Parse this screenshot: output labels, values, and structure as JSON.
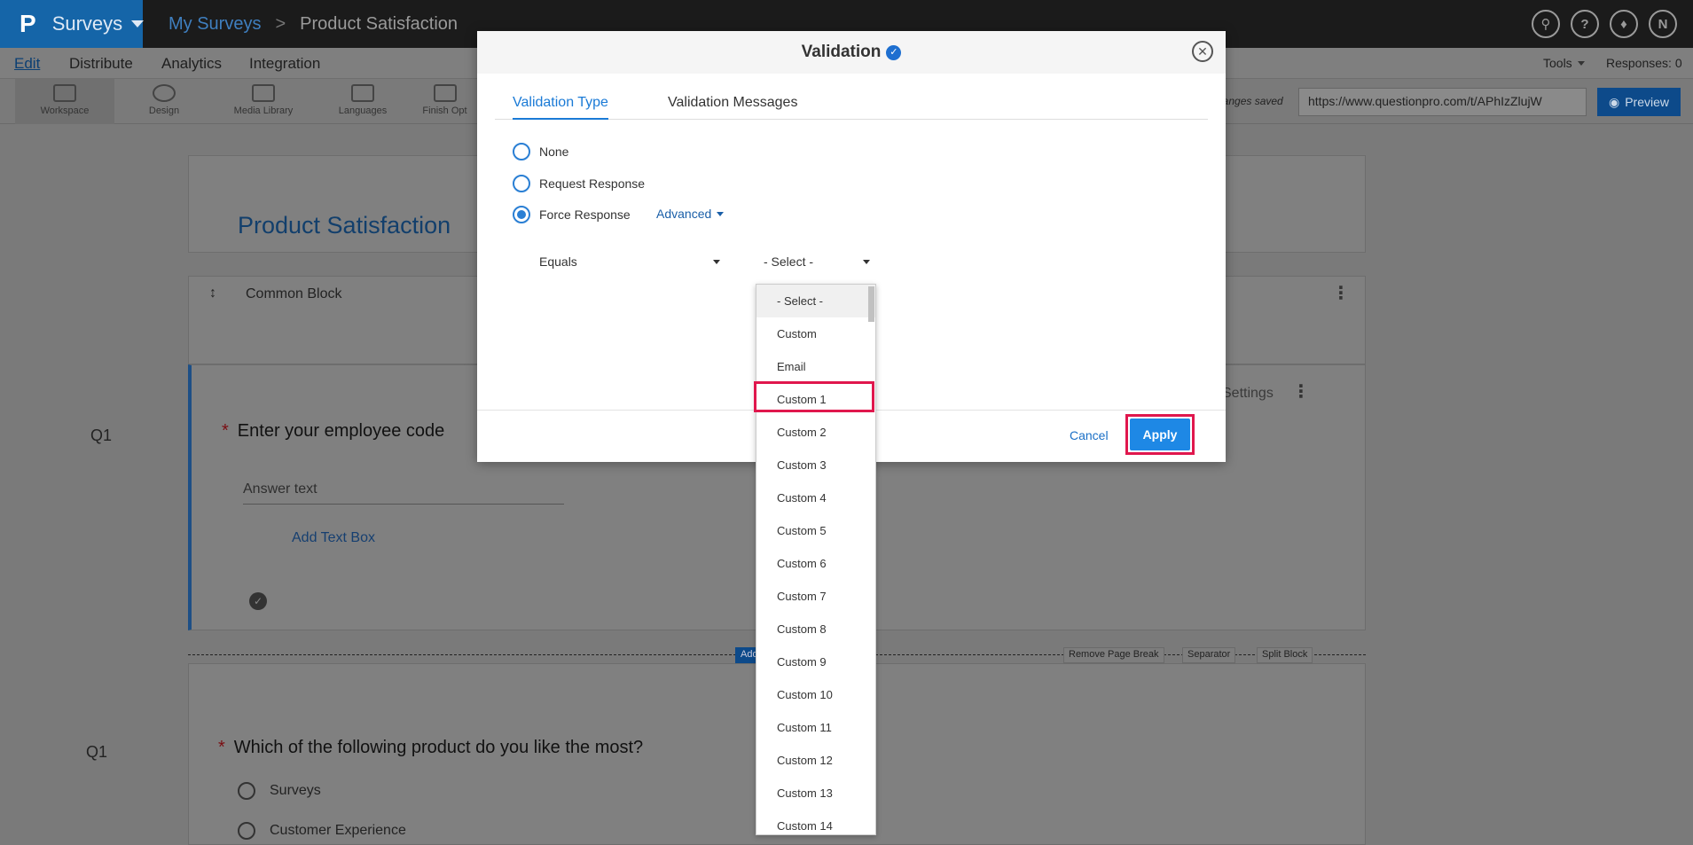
{
  "header": {
    "brand_logo": "P",
    "brand_name": "Surveys",
    "breadcrumb_1": "My Surveys",
    "breadcrumb_sep": ">",
    "breadcrumb_2": "Product Satisfaction",
    "icons": [
      "search-icon",
      "help-icon",
      "bell-icon",
      "user-avatar"
    ],
    "avatar_letter": "N"
  },
  "nav": {
    "items": [
      "Edit",
      "Distribute",
      "Analytics",
      "Integration"
    ],
    "tools": "Tools",
    "responses": "Responses: 0"
  },
  "toolbar": {
    "tools": [
      "Workspace",
      "Design",
      "Media Library",
      "Languages",
      "Finish Opt"
    ],
    "saved_status": "hanges saved",
    "url": "https://www.questionpro.com/t/APhIzZlujW",
    "preview_label": "Preview"
  },
  "survey": {
    "title": "Product Satisfaction",
    "block_label": "Common Block",
    "settings": "Settings",
    "q1_number": "Q1",
    "q1_text": "Enter your employee code",
    "q1_answer_placeholder": "Answer text",
    "add_text_box": "Add Text Box",
    "q2_number": "Q1",
    "q2_text": "Which of the following product do you like the most?",
    "q2_options": [
      "Surveys",
      "Customer Experience"
    ],
    "page_break_buttons": [
      "Remove Page Break",
      "Separator",
      "Split Block"
    ],
    "add_label": "Add"
  },
  "modal": {
    "title": "Validation",
    "tabs": [
      "Validation Type",
      "Validation Messages"
    ],
    "options": [
      "None",
      "Request Response",
      "Force Response"
    ],
    "selected_option": "Force Response",
    "advanced_label": "Advanced",
    "condition_select": "Equals",
    "value_select": "- Select -",
    "cancel_label": "Cancel",
    "apply_label": "Apply"
  },
  "dropdown": {
    "options": [
      "- Select -",
      "Custom",
      "Email",
      "Custom 1",
      "Custom 2",
      "Custom 3",
      "Custom 4",
      "Custom 5",
      "Custom 6",
      "Custom 7",
      "Custom 8",
      "Custom 9",
      "Custom 10",
      "Custom 11",
      "Custom 12",
      "Custom 13",
      "Custom 14"
    ],
    "highlighted": "Custom 1"
  },
  "colors": {
    "accent": "#1e88e5",
    "highlight": "#e0174d",
    "brand": "#1565a8"
  }
}
